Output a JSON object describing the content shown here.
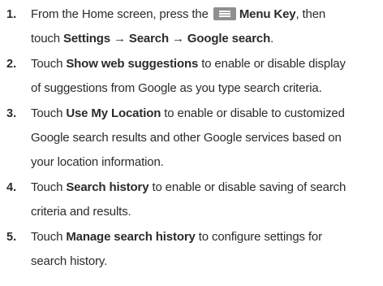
{
  "steps": [
    {
      "number": "1.",
      "line1": {
        "a": "From the Home screen, press the",
        "icon": "menu-key-icon",
        "b_bold": "Menu Key",
        "c": ", then"
      },
      "line2": {
        "a": "touch",
        "b_bold": "Settings → Search → Google search",
        "c": "."
      }
    },
    {
      "number": "2.",
      "line1": {
        "a": "Touch",
        "b_bold": "Show web suggestions",
        "c": "to enable or disable display"
      },
      "line2": {
        "a": "of suggestions from Google as you type search criteria."
      }
    },
    {
      "number": "3.",
      "line1": {
        "a": "Touch",
        "b_bold": "Use My Location",
        "c": "to enable or disable to customized"
      },
      "line2": {
        "a": "Google search results and other Google services based on"
      },
      "line3": {
        "a": "your location information."
      }
    },
    {
      "number": "4.",
      "line1": {
        "a": "Touch",
        "b_bold": "Search history",
        "c": "to enable or disable saving of search"
      },
      "line2": {
        "a": "criteria and results."
      }
    },
    {
      "number": "5.",
      "line1": {
        "a": "Touch",
        "b_bold": "Manage search history",
        "c": "to configure settings for"
      },
      "line2": {
        "a": "search history."
      }
    }
  ]
}
